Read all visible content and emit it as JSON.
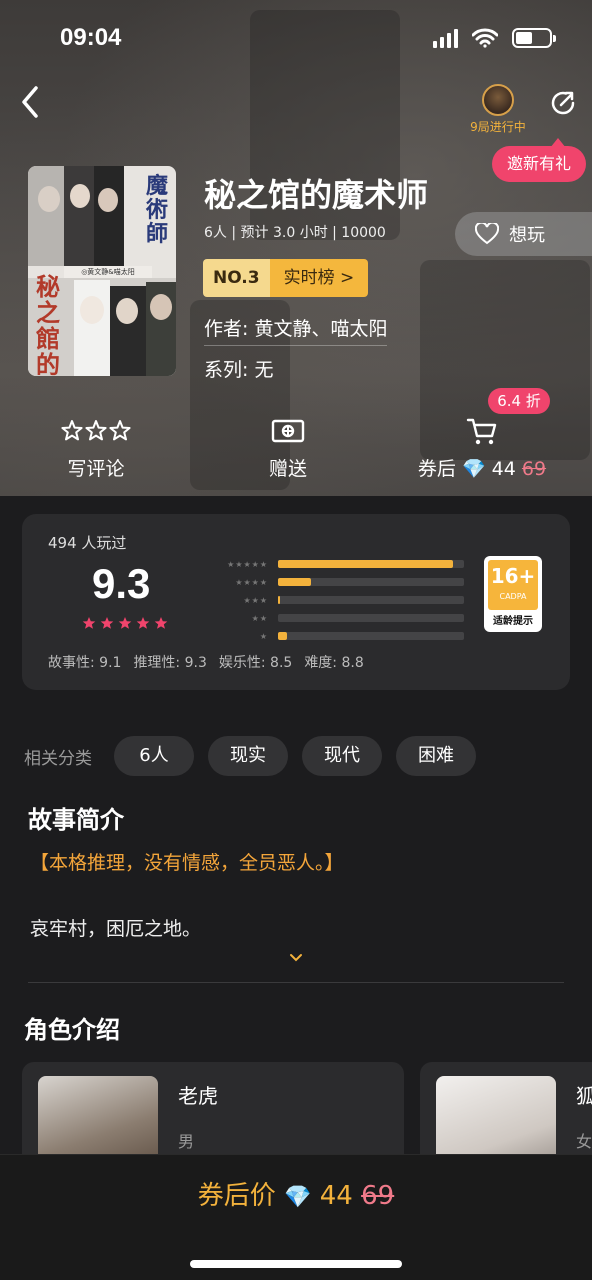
{
  "status": {
    "time": "09:04"
  },
  "header": {
    "progress_text": "9局进行中",
    "invite_label": "邀新有礼"
  },
  "cover": {
    "title_top": "魔術師",
    "title_bottom": "秘之館的",
    "authors_small": "◎黄文静&喵太阳"
  },
  "game": {
    "title": "秘之馆的魔术师",
    "meta": "6人 | 预计 3.0 小时 | 10000",
    "rank_no": "NO.3",
    "rank_label": "实时榜 >",
    "author": "作者: 黄文静、喵太阳",
    "series": "系列: 无",
    "want_label": "想玩"
  },
  "actions": {
    "review_label": "写评论",
    "gift_label": "赠送",
    "price_prefix": "券后",
    "price_now": "44",
    "price_old": "69",
    "discount_badge": "6.4 折"
  },
  "rating": {
    "played": "494 人玩过",
    "score": "9.3",
    "star_bars": [
      {
        "stars": "★★★★★",
        "fraction": 0.94
      },
      {
        "stars": "★★★★",
        "fraction": 0.18
      },
      {
        "stars": "★★★",
        "fraction": 0.01
      },
      {
        "stars": "★★",
        "fraction": 0.0
      },
      {
        "stars": "★",
        "fraction": 0.05
      }
    ],
    "age_num": "16+",
    "age_org": "CADPA",
    "age_tip": "适龄提示",
    "sub_scores": [
      "故事性: 9.1",
      "推理性: 9.3",
      "娱乐性: 8.5",
      "难度: 8.8"
    ]
  },
  "tags": {
    "label": "相关分类",
    "items": [
      "6人",
      "现实",
      "现代",
      "困难"
    ]
  },
  "story": {
    "title": "故事简介",
    "slogan": "【本格推理，没有情感，全员恶人。】",
    "intro": "哀牢村，困厄之地。"
  },
  "roles": {
    "title": "角色介绍",
    "items": [
      {
        "name": "老虎",
        "gender": "男"
      },
      {
        "name": "狐",
        "gender": "女"
      }
    ]
  },
  "bottom": {
    "label": "券后价",
    "price_now": "44",
    "price_old": "69"
  },
  "colors": {
    "accent": "#f3b23c",
    "pink": "#f0446c",
    "background": "#1c1c1e",
    "card": "#2b2b2d"
  }
}
